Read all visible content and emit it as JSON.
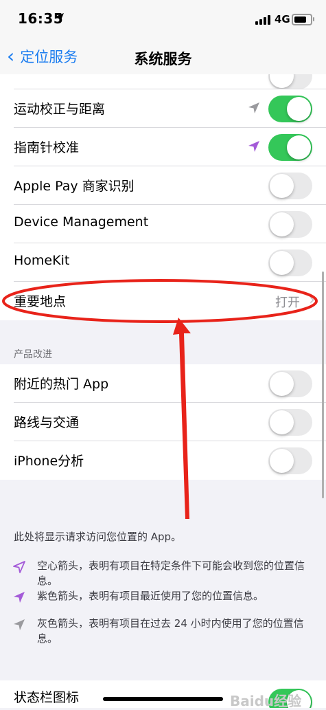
{
  "status": {
    "time": "16:35",
    "network": "4G"
  },
  "nav": {
    "back_label": "定位服务",
    "title": "系统服务"
  },
  "rows": [
    {
      "label": "运动校正与距离",
      "toggle": "on",
      "arrow": "gray-arrow-icon"
    },
    {
      "label": "指南针校准",
      "toggle": "on",
      "arrow": "purple-arrow-icon"
    },
    {
      "label": "Apple Pay 商家识别",
      "toggle": "off"
    },
    {
      "label": "Device Management",
      "toggle": "off"
    },
    {
      "label": "HomeKit",
      "toggle": "off"
    },
    {
      "label": "重要地点",
      "detail": "打开"
    }
  ],
  "section2": {
    "header": "产品改进",
    "rows": [
      {
        "label": "附近的热门 App",
        "toggle": "off"
      },
      {
        "label": "路线与交通",
        "toggle": "off"
      },
      {
        "label": "iPhone分析",
        "toggle": "off"
      }
    ]
  },
  "footer": {
    "intro": "此处将显示请求访问您位置的 App。",
    "legend": [
      {
        "icon": "hollow-arrow-icon",
        "text": "空心箭头，表明有项目在特定条件下可能会收到您的位置信息。"
      },
      {
        "icon": "purple-arrow-icon",
        "text": "紫色箭头，表明有项目最近使用了您的位置信息。"
      },
      {
        "icon": "gray-arrow-icon",
        "text": "灰色箭头，表明有项目在过去 24 小时内使用了您的位置信息。"
      }
    ]
  },
  "bottom_row": {
    "label": "状态栏图标",
    "toggle": "on"
  },
  "watermark": "Baidu经验",
  "colors": {
    "accent": "#1a7cf0",
    "toggle_on": "#34c759",
    "purple_arrow": "#a45bd8",
    "annotation_red": "#e8231a"
  }
}
